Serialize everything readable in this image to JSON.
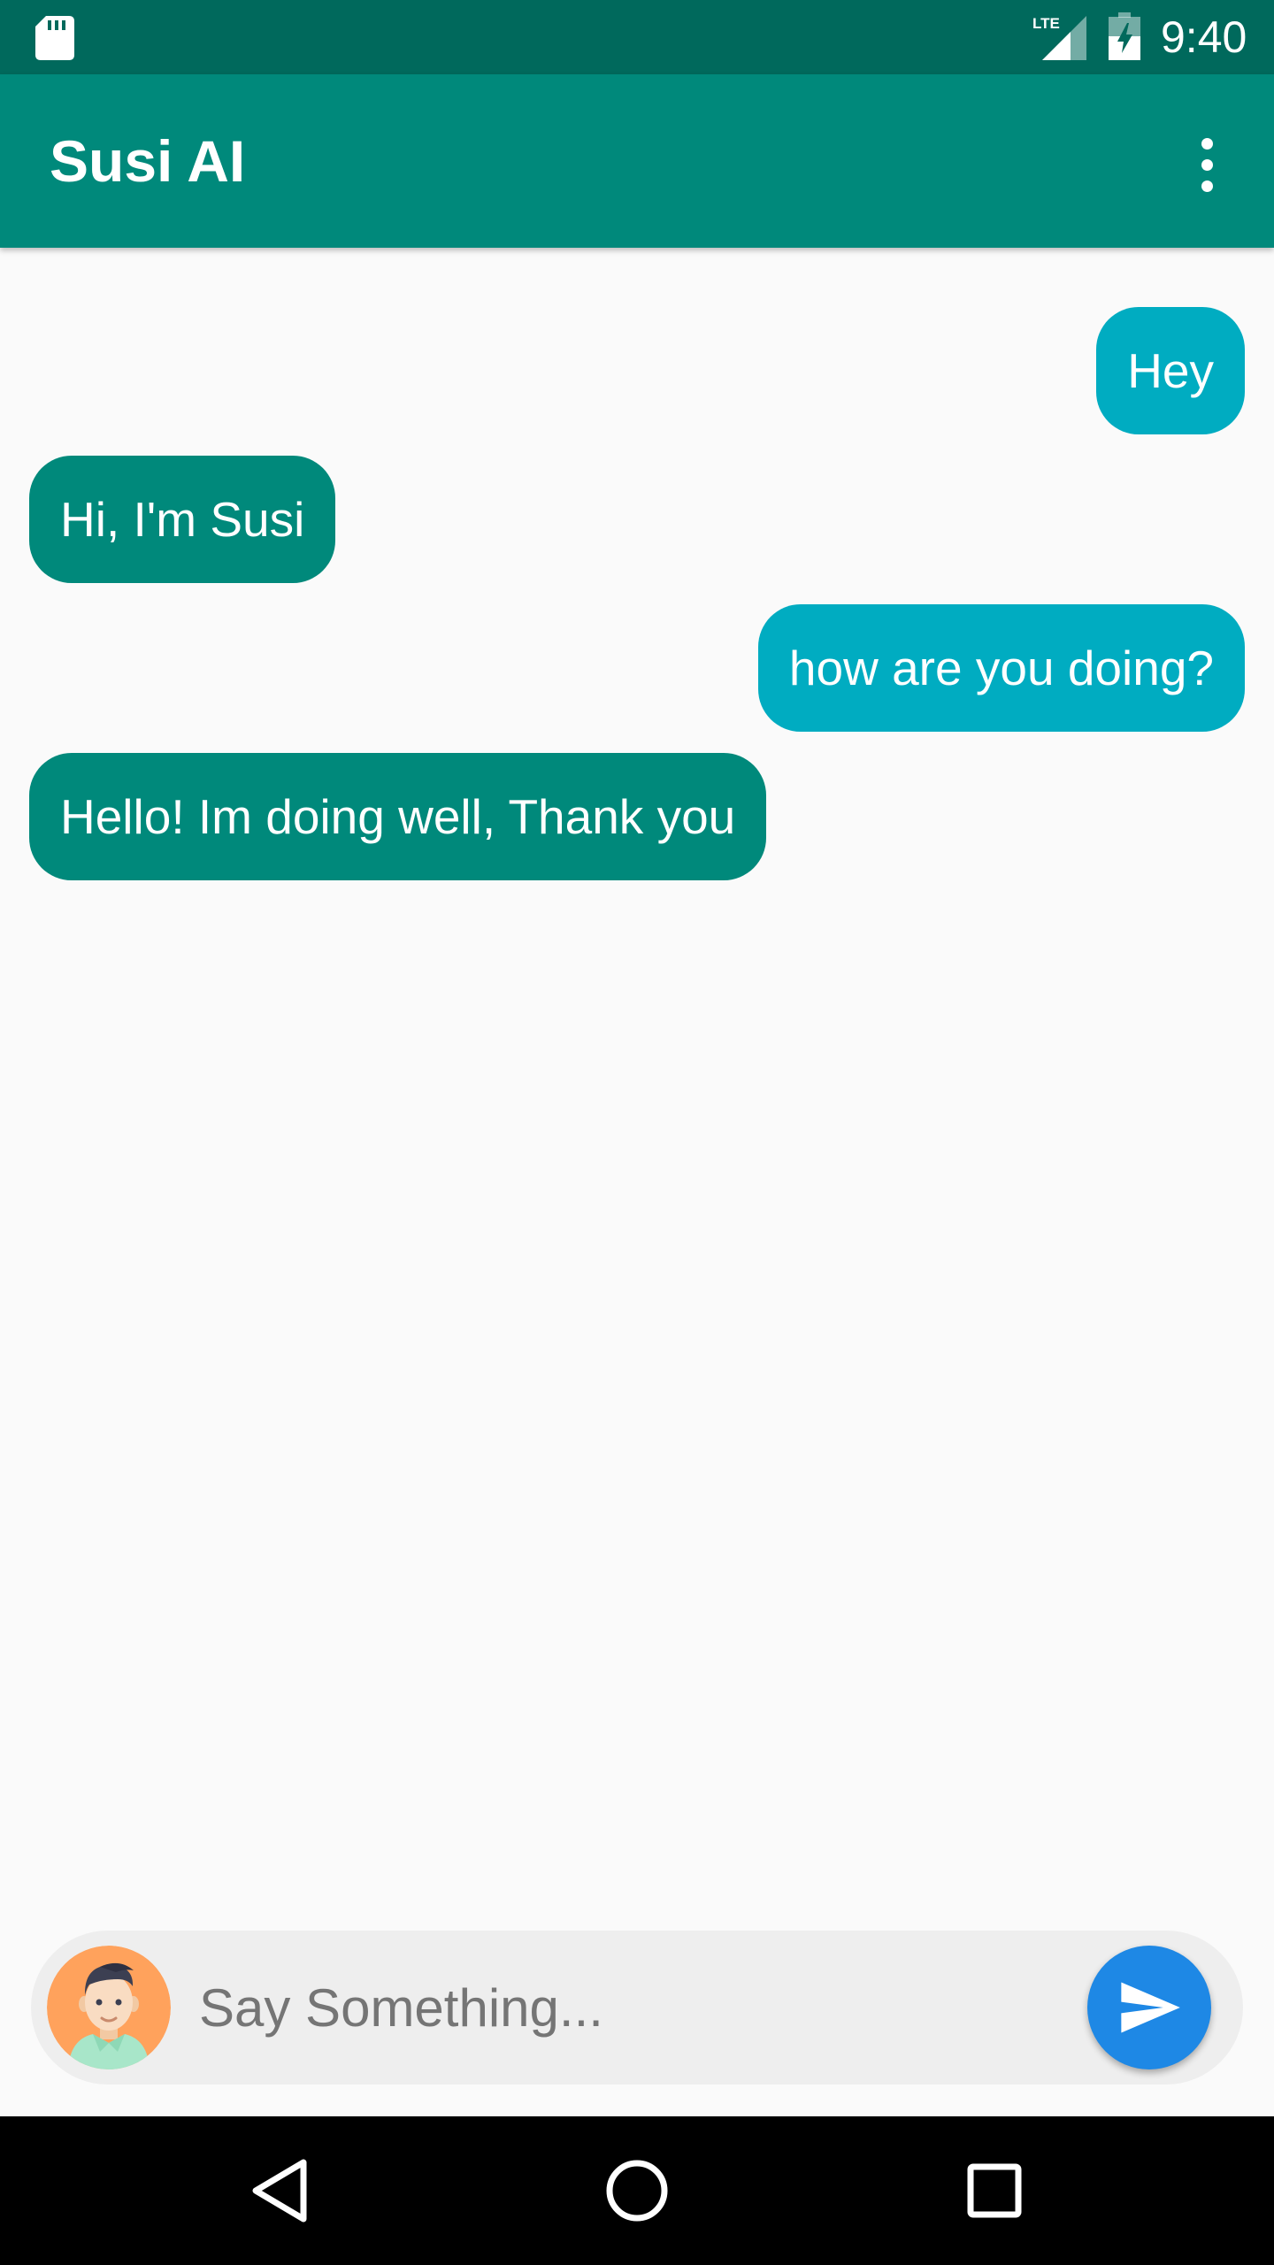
{
  "status_bar": {
    "time": "9:40",
    "network_label": "LTE",
    "icons": [
      "sd-card-icon",
      "lte-signal-icon",
      "battery-charging-icon"
    ]
  },
  "app_bar": {
    "title": "Susi AI",
    "menu_icon": "more-vert-icon"
  },
  "chat": {
    "messages": [
      {
        "sender": "user",
        "text": "Hey"
      },
      {
        "sender": "bot",
        "text": "Hi, I'm Susi"
      },
      {
        "sender": "user",
        "text": "how are you doing?"
      },
      {
        "sender": "bot",
        "text": "Hello! Im doing well, Thank you"
      }
    ]
  },
  "composer": {
    "placeholder": "Say Something...",
    "value": "",
    "avatar_icon": "user-avatar-icon",
    "send_icon": "send-icon"
  },
  "nav_bar": {
    "icons": [
      "back-icon",
      "home-icon",
      "recents-icon"
    ]
  },
  "colors": {
    "status_bar": "#00695C",
    "app_bar": "#00897B",
    "user_bubble": "#00ACC1",
    "bot_bubble": "#00897B",
    "background": "#FAFAFA",
    "send_button": "#1E88E5",
    "composer_background": "#EEEEEE"
  }
}
